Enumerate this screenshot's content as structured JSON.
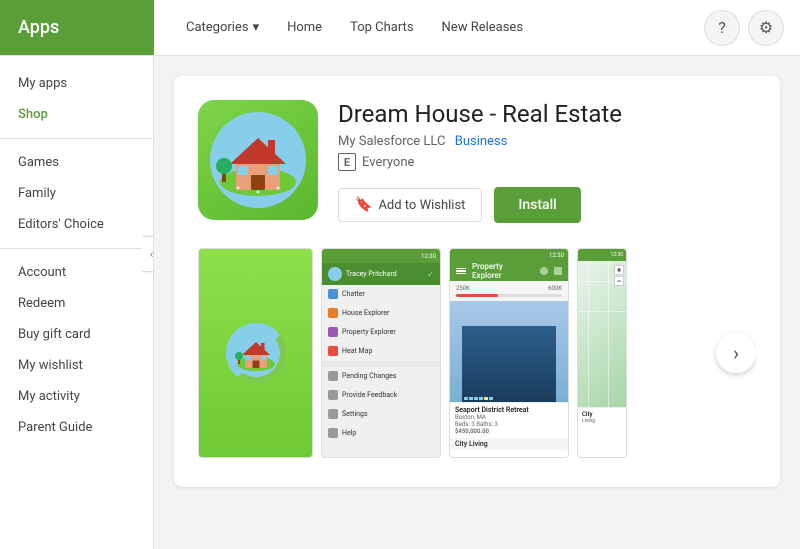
{
  "header": {
    "brand": "Apps",
    "nav": {
      "categories_label": "Categories",
      "home_label": "Home",
      "top_charts_label": "Top Charts",
      "new_releases_label": "New Releases"
    }
  },
  "sidebar": {
    "my_apps_label": "My apps",
    "shop_label": "Shop",
    "games_label": "Games",
    "family_label": "Family",
    "editors_choice_label": "Editors' Choice",
    "account_label": "Account",
    "redeem_label": "Redeem",
    "buy_gift_card_label": "Buy gift card",
    "my_wishlist_label": "My wishlist",
    "my_activity_label": "My activity",
    "parent_guide_label": "Parent Guide"
  },
  "app": {
    "title": "Dream House - Real Estate",
    "developer": "My Salesforce LLC",
    "category": "Business",
    "rating": "Everyone",
    "rating_badge": "E",
    "wishlist_label": "Add to Wishlist",
    "install_label": "Install"
  },
  "screenshots": {
    "prev_label": "‹",
    "next_label": "›"
  },
  "phone": {
    "status_bar": "12:30",
    "header_user": "Tracey Pritchard",
    "menu": [
      {
        "label": "Chatter",
        "color": "blue"
      },
      {
        "label": "House Explorer",
        "color": "orange"
      },
      {
        "label": "Property Explorer",
        "color": "purple"
      },
      {
        "label": "Heat Map",
        "color": "red"
      }
    ],
    "menu2": [
      {
        "label": "Pending Changes",
        "color": "green"
      },
      {
        "label": "Provide Feedback",
        "color": "green"
      },
      {
        "label": "Settings",
        "color": "green"
      },
      {
        "label": "Help",
        "color": "green"
      }
    ]
  },
  "property_explorer": {
    "title": "Property Explorer",
    "range_min": "250K",
    "range_max": "600K",
    "card_title": "Seaport District Retreat",
    "card_sub1": "Boston, MA",
    "card_sub2": "Beds: 3  Baths: 3",
    "card_price": "$450,000.00",
    "card_title2": "City Living"
  },
  "icons": {
    "question_mark": "?",
    "settings_gear": "⚙",
    "chevron_down": "▾",
    "bookmark": "🔖",
    "check_mark": "✓"
  }
}
